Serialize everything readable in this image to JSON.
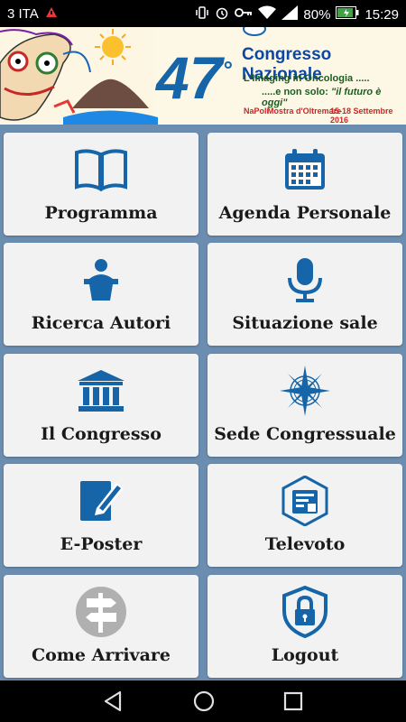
{
  "status": {
    "carrier": "3 ITA",
    "battery": "80%",
    "time": "15:29"
  },
  "banner": {
    "edition": "47",
    "title": "Congresso Nazionale",
    "subtitle1": "L'Imaging in Oncologia .....",
    "subtitle2a": ".....e non solo: ",
    "subtitle2b": "\"il futuro è oggi\"",
    "city": "NaPoli",
    "venue": "Mostra d'Oltremare",
    "dates": "15-18 Settembre 2016"
  },
  "tiles": [
    {
      "label": "Programma",
      "icon": "book-icon"
    },
    {
      "label": "Agenda Personale",
      "icon": "calendar-icon"
    },
    {
      "label": "Ricerca Autori",
      "icon": "speaker-podium-icon"
    },
    {
      "label": "Situazione sale",
      "icon": "microphone-icon"
    },
    {
      "label": "Il Congresso",
      "icon": "institution-icon"
    },
    {
      "label": "Sede Congressuale",
      "icon": "compass-rose-icon"
    },
    {
      "label": "E-Poster",
      "icon": "edit-document-icon"
    },
    {
      "label": "Televoto",
      "icon": "voting-device-icon"
    },
    {
      "label": "Come Arrivare",
      "icon": "signpost-icon"
    },
    {
      "label": "Logout",
      "icon": "shield-lock-icon"
    }
  ],
  "colors": {
    "accent": "#1565a8",
    "background": "#6a8db0",
    "tile": "#f2f2f2"
  }
}
